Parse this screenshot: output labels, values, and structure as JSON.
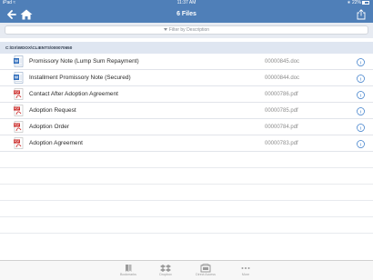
{
  "status_bar": {
    "device": "iPad",
    "time": "11:37 AM",
    "battery": "22%"
  },
  "nav": {
    "title": "6 Files"
  },
  "filter": {
    "placeholder": "Filter by Description"
  },
  "path": "C:\\DX\\WDOX\\CLIENTS\\000070650",
  "files": [
    {
      "name": "Promissory Note (Lump Sum Repayment)",
      "id": "00000845.doc",
      "type": "doc"
    },
    {
      "name": "Installment Promissory Note (Secured)",
      "id": "00000844.doc",
      "type": "doc"
    },
    {
      "name": "Contact After Adoption Agreement",
      "id": "00000786.pdf",
      "type": "pdf"
    },
    {
      "name": "Adoption Request",
      "id": "00000785.pdf",
      "type": "pdf"
    },
    {
      "name": "Adoption Order",
      "id": "00000784.pdf",
      "type": "pdf"
    },
    {
      "name": "Adoption Agreement",
      "id": "00000783.pdf",
      "type": "pdf"
    }
  ],
  "tabs": [
    {
      "label": "Bookmarks",
      "icon": "bookmarks-icon"
    },
    {
      "label": "Dropbox",
      "icon": "dropbox-icon"
    },
    {
      "label": "Direct Access",
      "icon": "direct-access-icon"
    },
    {
      "label": "More",
      "icon": "more-icon"
    }
  ],
  "colors": {
    "nav_bg": "#4f7fb8",
    "path_bg": "#dfe6f1",
    "info": "#3478c8",
    "pdf_red": "#c8201e",
    "doc_blue": "#2f6dbb"
  }
}
